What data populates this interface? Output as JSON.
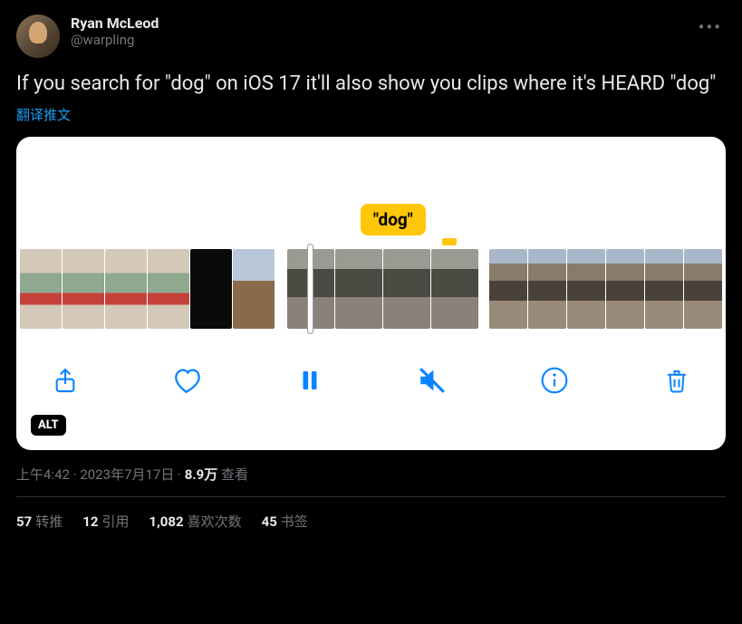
{
  "author": {
    "display_name": "Ryan McLeod",
    "handle": "@warpling"
  },
  "tweet_text": "If you search for \"dog\" on iOS 17 it'll also show you clips where it's HEARD \"dog\"",
  "translate_label": "翻译推文",
  "media": {
    "tag_label": "\"dog\"",
    "alt_badge": "ALT"
  },
  "meta": {
    "time": "上午4:42",
    "date": "2023年7月17日",
    "views_count": "8.9万",
    "views_label": "查看"
  },
  "stats": {
    "retweets_count": "57",
    "retweets_label": "转推",
    "quotes_count": "12",
    "quotes_label": "引用",
    "likes_count": "1,082",
    "likes_label": "喜欢次数",
    "bookmarks_count": "45",
    "bookmarks_label": "书签"
  }
}
